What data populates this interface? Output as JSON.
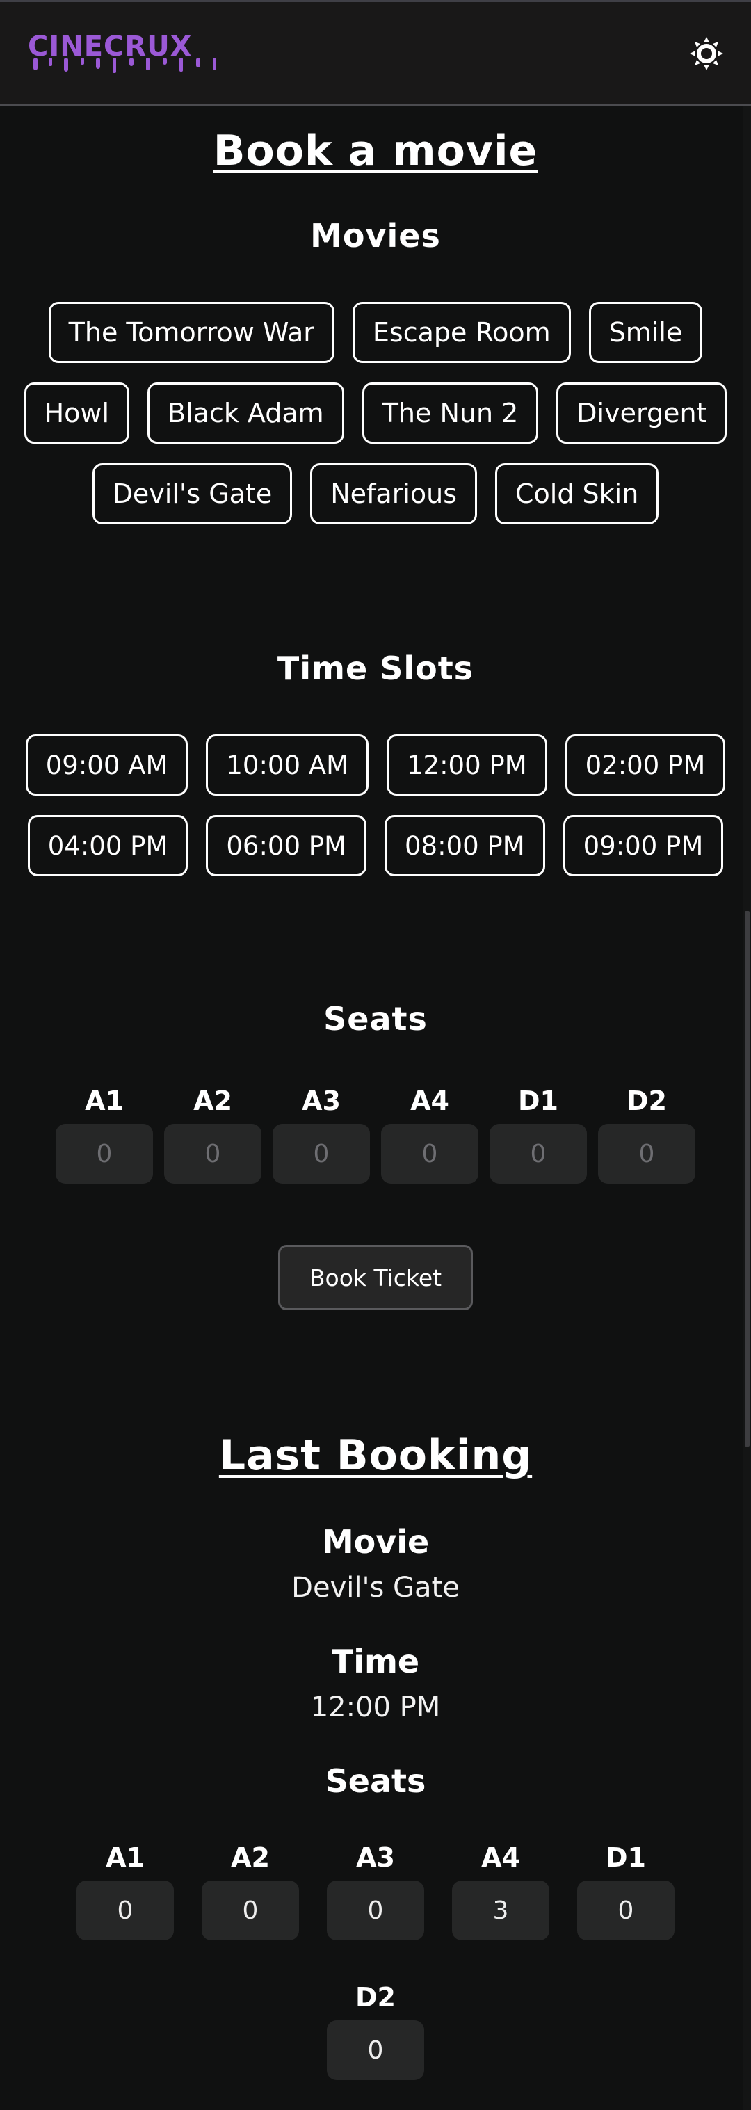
{
  "header": {
    "logo_text": "CINECRUX",
    "theme_icon": "sun-icon",
    "brand_color": "#9b59d6"
  },
  "booking": {
    "title": "Book a movie",
    "movies_heading": "Movies",
    "movies": [
      "The Tomorrow War",
      "Escape Room",
      "Smile",
      "Howl",
      "Black Adam",
      "The Nun 2",
      "Divergent",
      "Devil's Gate",
      "Nefarious",
      "Cold Skin"
    ],
    "time_heading": "Time Slots",
    "times": [
      "09:00 AM",
      "10:00 AM",
      "12:00 PM",
      "02:00 PM",
      "04:00 PM",
      "06:00 PM",
      "08:00 PM",
      "09:00 PM"
    ],
    "seats_heading": "Seats",
    "seats": [
      {
        "label": "A1",
        "value": "0"
      },
      {
        "label": "A2",
        "value": "0"
      },
      {
        "label": "A3",
        "value": "0"
      },
      {
        "label": "A4",
        "value": "0"
      },
      {
        "label": "D1",
        "value": "0"
      },
      {
        "label": "D2",
        "value": "0"
      }
    ],
    "book_button": "Book Ticket"
  },
  "last_booking": {
    "title": "Last Booking",
    "movie_label": "Movie",
    "movie": "Devil's Gate",
    "time_label": "Time",
    "time": "12:00 PM",
    "seats_label": "Seats",
    "seats": [
      {
        "label": "A1",
        "value": "0"
      },
      {
        "label": "A2",
        "value": "0"
      },
      {
        "label": "A3",
        "value": "0"
      },
      {
        "label": "A4",
        "value": "3"
      },
      {
        "label": "D1",
        "value": "0"
      },
      {
        "label": "D2",
        "value": "0"
      }
    ]
  }
}
